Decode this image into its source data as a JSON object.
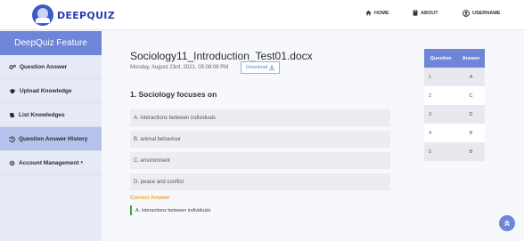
{
  "brand": {
    "name": "DEEPQUIZ"
  },
  "nav": {
    "home": "HOME",
    "about": "ABOUT",
    "user": "USERNAME"
  },
  "sidebar": {
    "title": "DeepQuiz Feature",
    "items": [
      {
        "label": "Question Answer",
        "icon": "gears-icon"
      },
      {
        "label": "Upload Knowledge",
        "icon": "graduation-cap-icon"
      },
      {
        "label": "List Knowledges",
        "icon": "book-icon"
      },
      {
        "label": "Question Answer History",
        "icon": "history-icon",
        "active": true
      },
      {
        "label": "Account Management",
        "icon": "gear-icon",
        "caret": "▾"
      }
    ]
  },
  "document": {
    "title": "Sociology11_Introduction_Test01.docx",
    "date": "Monday, August 23rd, 2021, 05:08:08 PM",
    "download_label": "Download"
  },
  "question": {
    "title": "1. Sociology focuses on",
    "options": [
      "A. interactions between individuals",
      "B. animal behaviour",
      "C. environment",
      "D. peace and conflict"
    ],
    "correct_label": "Correct Answer",
    "correct_answer": "A. interactions between individuals"
  },
  "answer_table": {
    "headers": [
      "Question",
      "Answer"
    ],
    "rows": [
      [
        "1",
        "A"
      ],
      [
        "2",
        "C"
      ],
      [
        "3",
        "D"
      ],
      [
        "4",
        "B"
      ],
      [
        "5",
        "B"
      ]
    ]
  },
  "colors": {
    "accent": "#6e85d8",
    "sidebar_bg": "#e6eaf6",
    "active_item": "#b5c2ec",
    "correct_label": "#e8a534",
    "correct_bar": "#3ca24a"
  }
}
